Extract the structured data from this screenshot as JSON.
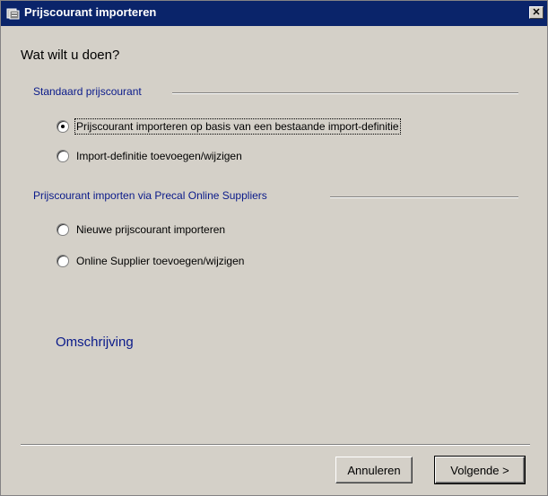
{
  "window": {
    "title": "Prijscourant importeren",
    "close_label": "✕"
  },
  "question": "Wat wilt u doen?",
  "groups": [
    {
      "label": "Standaard prijscourant",
      "options": [
        {
          "label": "Prijscourant importeren op basis van een bestaande import-definitie",
          "checked": true
        },
        {
          "label": "Import-definitie toevoegen/wijzigen",
          "checked": false
        }
      ]
    },
    {
      "label": "Prijscourant importen via Precal Online Suppliers",
      "options": [
        {
          "label": "Nieuwe prijscourant importeren",
          "checked": false
        },
        {
          "label": "Online Supplier toevoegen/wijzigen",
          "checked": false
        }
      ]
    }
  ],
  "description_label": "Omschrijving",
  "buttons": {
    "cancel": "Annuleren",
    "next": "Volgende >"
  }
}
